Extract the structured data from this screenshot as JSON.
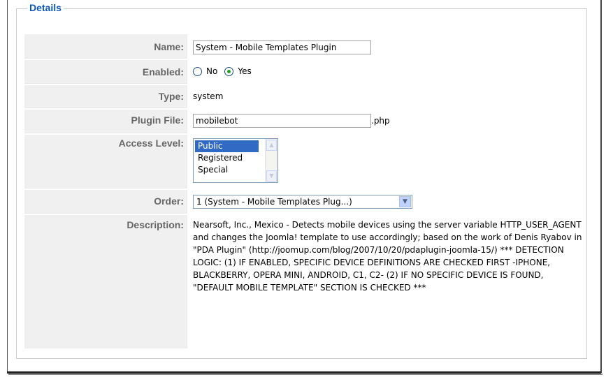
{
  "fieldset": {
    "legend": "Details"
  },
  "fields": {
    "name": {
      "label": "Name:",
      "value": "System - Mobile Templates Plugin"
    },
    "enabled": {
      "label": "Enabled:",
      "options": [
        "No",
        "Yes"
      ],
      "selected": "Yes"
    },
    "type": {
      "label": "Type:",
      "value": "system"
    },
    "plugin_file": {
      "label": "Plugin File:",
      "value": "mobilebot",
      "suffix": ".php"
    },
    "access_level": {
      "label": "Access Level:",
      "options": [
        "Public",
        "Registered",
        "Special"
      ],
      "selected": "Public"
    },
    "order": {
      "label": "Order:",
      "value": "1 (System - Mobile Templates Plug...)"
    },
    "description": {
      "label": "Description:",
      "text": "Nearsoft, Inc., Mexico - Detects mobile devices using the server variable HTTP_USER_AGENT and changes the Joomla! template to use accordingly; based on the work of Denis Ryabov in \"PDA Plugin\" (http://joomup.com/blog/2007/10/20/pdaplugin-joomla-15/) *** DETECTION LOGIC: (1) IF ENABLED, SPECIFIC DEVICE DEFINITIONS ARE CHECKED FIRST -IPHONE, BLACKBERRY, OPERA MINI, ANDROID, C1, C2- (2) IF NO SPECIFIC DEVICE IS FOUND, \"DEFAULT MOBILE TEMPLATE\" SECTION IS CHECKED ***"
    }
  },
  "colors": {
    "legend": "#0b55c4",
    "label_bg": "#f0f0f0",
    "selected_option": "#316ac5"
  }
}
